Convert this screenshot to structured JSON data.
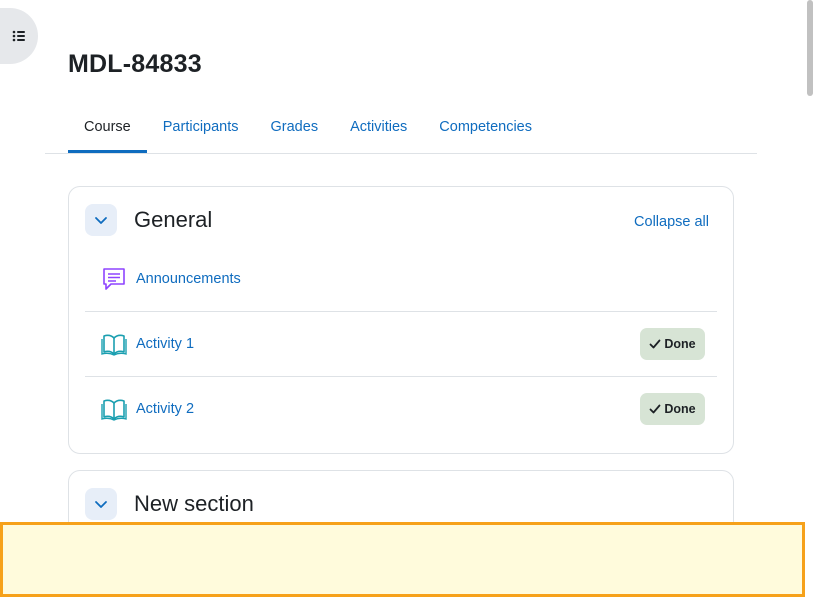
{
  "page": {
    "title": "MDL-84833"
  },
  "tabs": [
    {
      "label": "Course",
      "active": true
    },
    {
      "label": "Participants",
      "active": false
    },
    {
      "label": "Grades",
      "active": false
    },
    {
      "label": "Activities",
      "active": false
    },
    {
      "label": "Competencies",
      "active": false
    }
  ],
  "sections": {
    "general": {
      "title": "General",
      "collapse_all": "Collapse all",
      "activities": [
        {
          "name": "Announcements",
          "icon": "forum-icon",
          "status": ""
        },
        {
          "name": "Activity 1",
          "icon": "book-icon",
          "status": "Done"
        },
        {
          "name": "Activity 2",
          "icon": "book-icon",
          "status": "Done"
        }
      ]
    },
    "new_section": {
      "title": "New section"
    }
  },
  "colors": {
    "link": "#0f6cbf",
    "forum_icon": "#8e44ff",
    "book_icon": "#1a9fb0",
    "done_bg": "#d7e4d5",
    "banner_bg": "#fffbdc",
    "banner_border": "#f6a11a"
  }
}
